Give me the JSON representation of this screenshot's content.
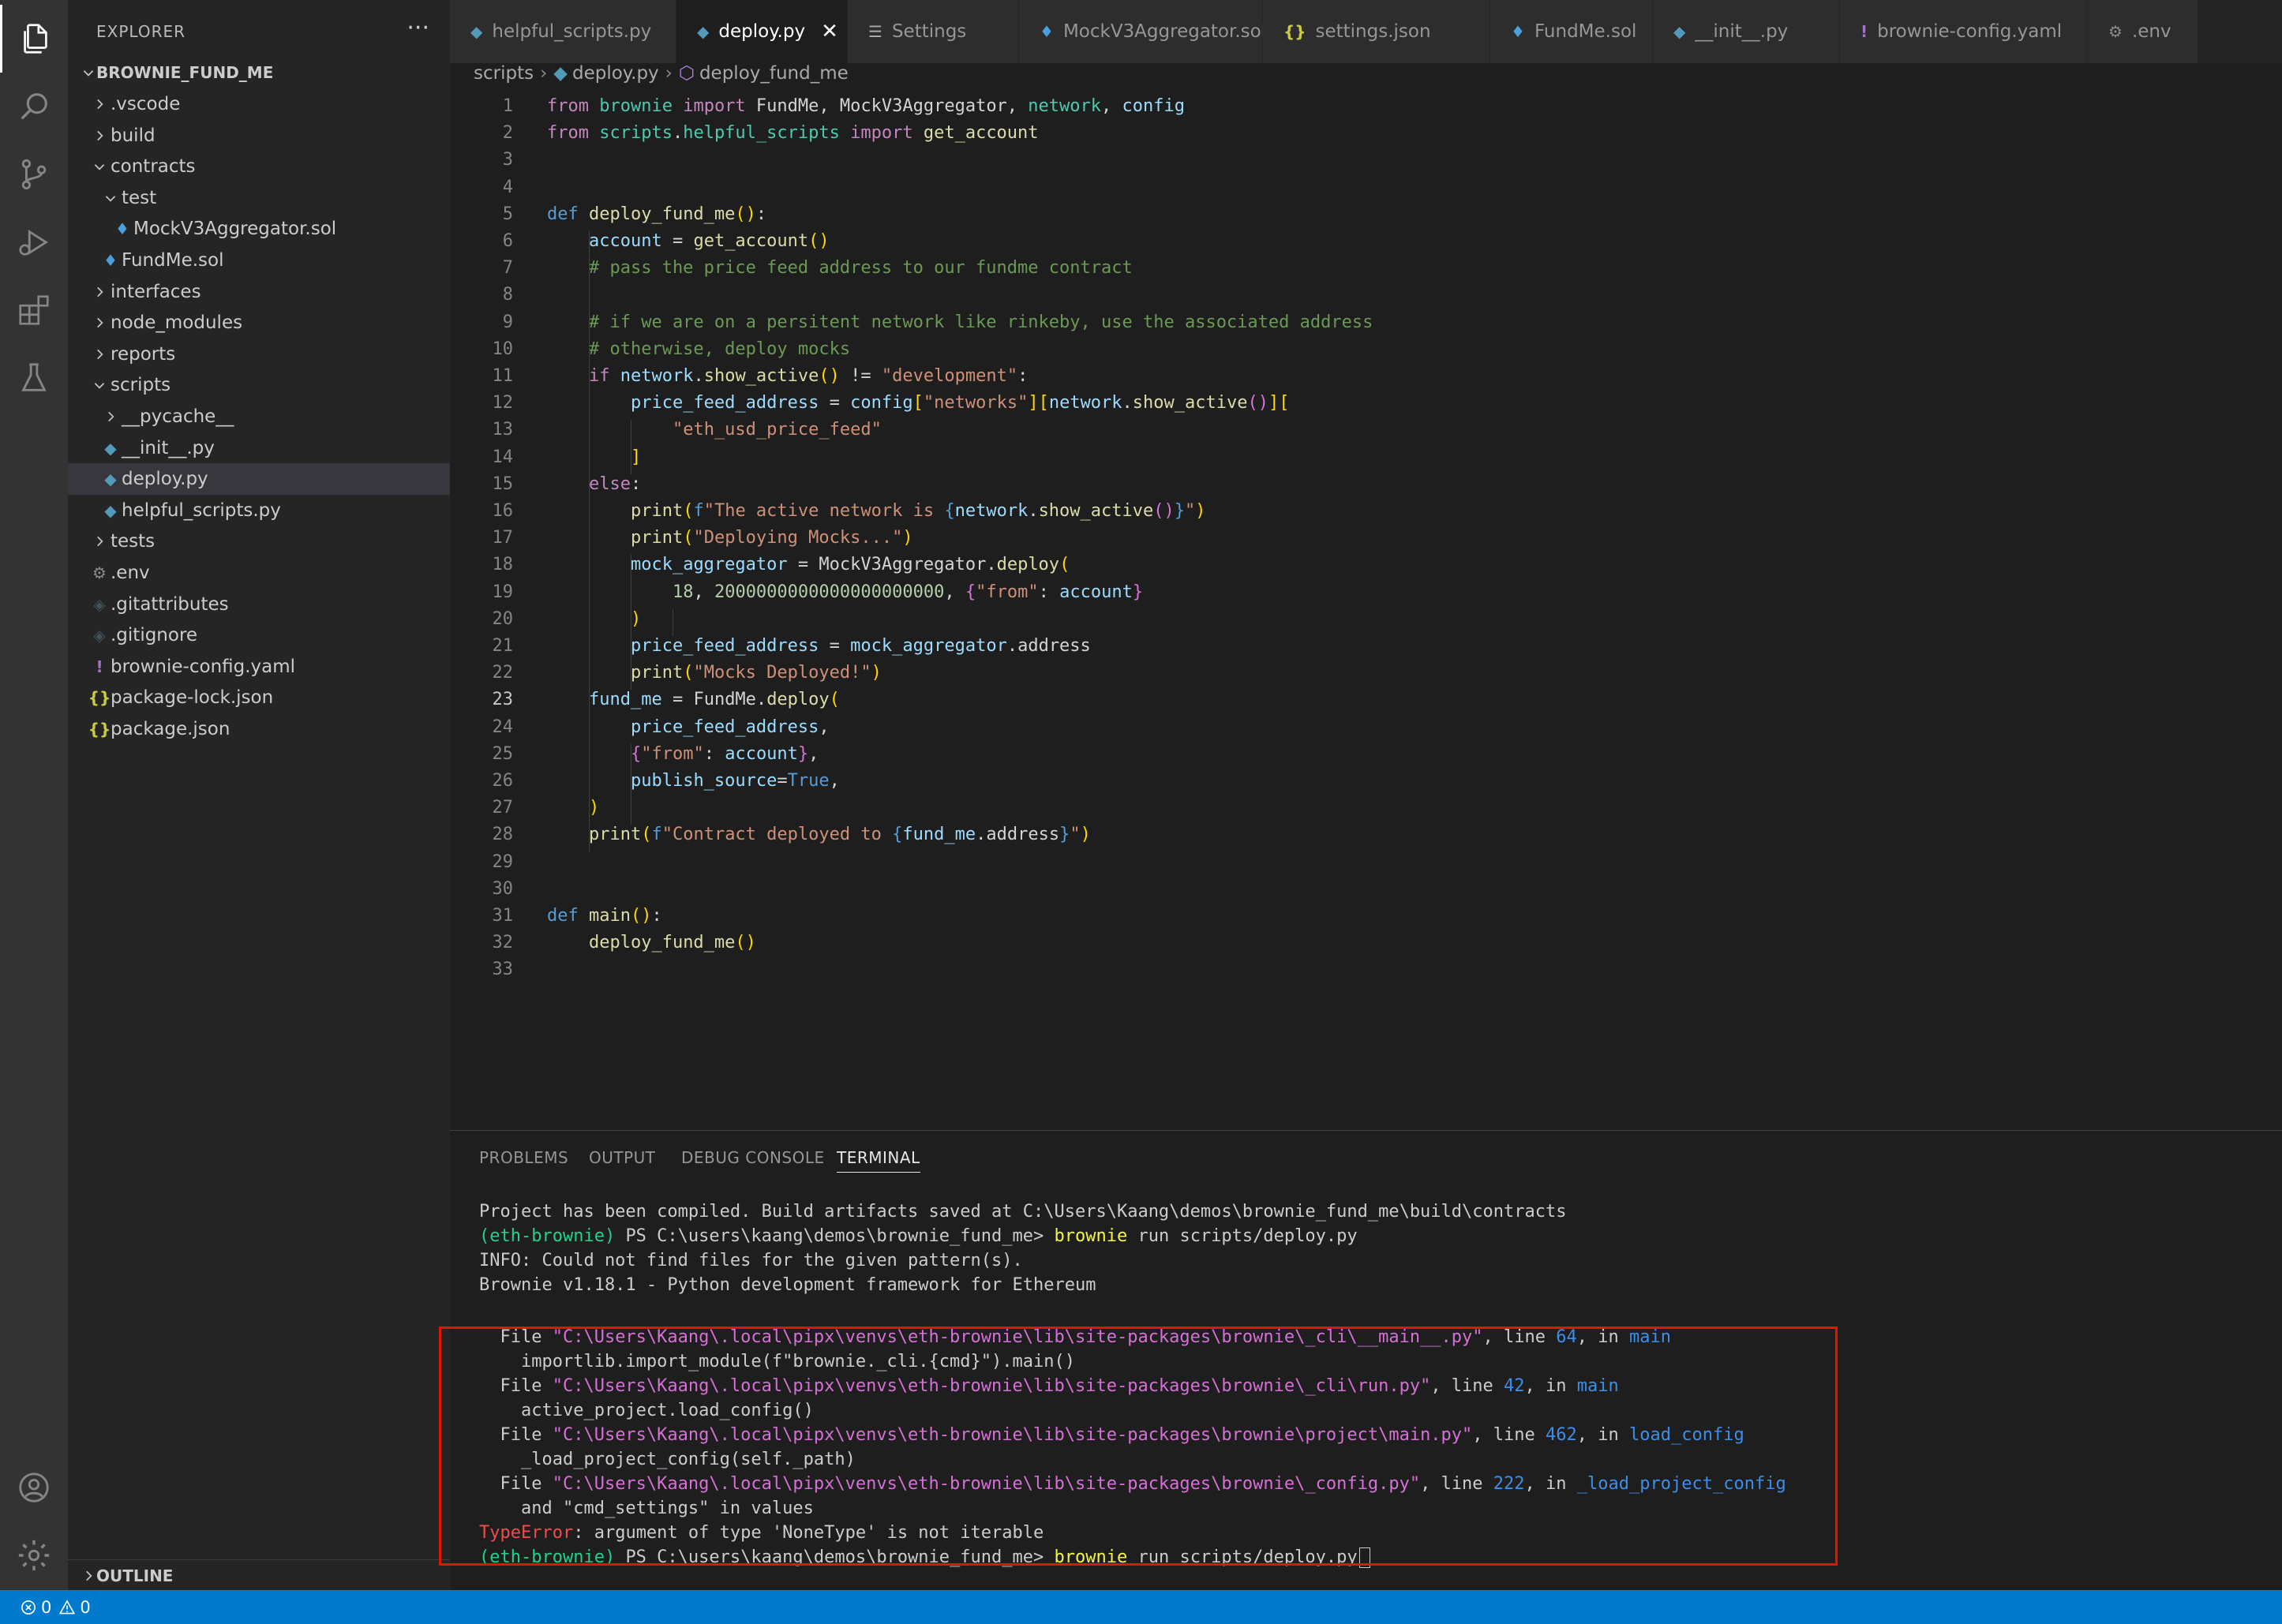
{
  "activity_bar": {
    "items": [
      "files-icon",
      "search-icon",
      "source-control-icon",
      "run-debug-icon",
      "extensions-icon",
      "testing-icon"
    ],
    "bottom": [
      "account-icon",
      "settings-gear-icon"
    ]
  },
  "sidebar": {
    "title": "EXPLORER",
    "more": "···",
    "root": "BROWNIE_FUND_ME",
    "items": [
      {
        "label": ".vscode",
        "kind": "folder",
        "open": false
      },
      {
        "label": "build",
        "kind": "folder",
        "open": false
      },
      {
        "label": "contracts",
        "kind": "folder",
        "open": true
      },
      {
        "label": "test",
        "kind": "folder",
        "open": true
      },
      {
        "label": "MockV3Aggregator.sol",
        "kind": "sol"
      },
      {
        "label": "FundMe.sol",
        "kind": "sol"
      },
      {
        "label": "interfaces",
        "kind": "folder",
        "open": false
      },
      {
        "label": "node_modules",
        "kind": "folder",
        "open": false
      },
      {
        "label": "reports",
        "kind": "folder",
        "open": false
      },
      {
        "label": "scripts",
        "kind": "folder",
        "open": true
      },
      {
        "label": "__pycache__",
        "kind": "folder",
        "open": false
      },
      {
        "label": "__init__.py",
        "kind": "py"
      },
      {
        "label": "deploy.py",
        "kind": "py",
        "selected": true
      },
      {
        "label": "helpful_scripts.py",
        "kind": "py"
      },
      {
        "label": "tests",
        "kind": "folder",
        "open": false
      },
      {
        "label": ".env",
        "kind": "gear"
      },
      {
        "label": ".gitattributes",
        "kind": "git"
      },
      {
        "label": ".gitignore",
        "kind": "git"
      },
      {
        "label": "brownie-config.yaml",
        "kind": "yaml"
      },
      {
        "label": "package-lock.json",
        "kind": "json"
      },
      {
        "label": "package.json",
        "kind": "json"
      }
    ],
    "outline": "OUTLINE"
  },
  "tabs": [
    {
      "label": "helpful_scripts.py",
      "icon": "python-file-icon"
    },
    {
      "label": "deploy.py",
      "icon": "python-file-icon",
      "active": true,
      "close": "✕"
    },
    {
      "label": "Settings",
      "icon": "settings-list-icon"
    },
    {
      "label": "MockV3Aggregator.sol",
      "icon": "solidity-file-icon"
    },
    {
      "label": "settings.json",
      "icon": "json-file-icon"
    },
    {
      "label": "FundMe.sol",
      "icon": "solidity-file-icon"
    },
    {
      "label": "__init__.py",
      "icon": "python-file-icon"
    },
    {
      "label": "brownie-config.yaml",
      "icon": "yaml-file-icon"
    },
    {
      "label": ".env",
      "icon": "env-gear-icon"
    }
  ],
  "breadcrumb": {
    "parts": [
      "scripts",
      "deploy.py",
      "deploy_fund_me"
    ]
  },
  "editor": {
    "current_line": 23,
    "lines": [
      [
        [
          "from ",
          "kw"
        ],
        [
          "brownie ",
          "cls"
        ],
        [
          "import ",
          "kw"
        ],
        [
          "FundMe, MockV3Aggregator, ",
          ""
        ],
        [
          "network",
          "cls"
        ],
        [
          ", ",
          ""
        ],
        [
          "config",
          "var"
        ]
      ],
      [
        [
          "from ",
          "kw"
        ],
        [
          "scripts",
          "cls"
        ],
        [
          ".",
          ""
        ],
        [
          "helpful_scripts ",
          "cls"
        ],
        [
          "import ",
          "kw"
        ],
        [
          "get_account",
          "fn"
        ]
      ],
      [],
      [],
      [
        [
          "def ",
          "kw2"
        ],
        [
          "deploy_fund_me",
          "fn"
        ],
        [
          "()",
          "p1"
        ],
        [
          ":",
          ""
        ]
      ],
      [
        [
          "    ",
          ""
        ],
        [
          "account",
          "var"
        ],
        [
          " = ",
          ""
        ],
        [
          "get_account",
          "fn"
        ],
        [
          "()",
          "p1"
        ]
      ],
      [
        [
          "    # pass the price feed address to our fundme contract",
          "cm"
        ]
      ],
      [],
      [
        [
          "    # if we are on a persitent network like rinkeby, use the associated address",
          "cm"
        ]
      ],
      [
        [
          "    # otherwise, deploy mocks",
          "cm"
        ]
      ],
      [
        [
          "    ",
          ""
        ],
        [
          "if ",
          "kw"
        ],
        [
          "network",
          "var"
        ],
        [
          ".",
          ""
        ],
        [
          "show_active",
          "fn"
        ],
        [
          "()",
          "p1"
        ],
        [
          " != ",
          ""
        ],
        [
          "\"development\"",
          "str"
        ],
        [
          ":",
          ""
        ]
      ],
      [
        [
          "        ",
          ""
        ],
        [
          "price_feed_address",
          "var"
        ],
        [
          " = ",
          ""
        ],
        [
          "config",
          "var"
        ],
        [
          "[",
          "p1"
        ],
        [
          "\"networks\"",
          "str"
        ],
        [
          "]",
          "p1"
        ],
        [
          "[",
          "p1"
        ],
        [
          "network",
          "var"
        ],
        [
          ".",
          ""
        ],
        [
          "show_active",
          "fn"
        ],
        [
          "()",
          "p2"
        ],
        [
          "]",
          "p1"
        ],
        [
          "[",
          "p1"
        ]
      ],
      [
        [
          "            ",
          ""
        ],
        [
          "\"eth_usd_price_feed\"",
          "str"
        ]
      ],
      [
        [
          "        ",
          ""
        ],
        [
          "]",
          "p1"
        ]
      ],
      [
        [
          "    ",
          ""
        ],
        [
          "else",
          "kw"
        ],
        [
          ":",
          ""
        ]
      ],
      [
        [
          "        ",
          ""
        ],
        [
          "print",
          "fn"
        ],
        [
          "(",
          "p1"
        ],
        [
          "f",
          "kw2"
        ],
        [
          "\"The active network is ",
          "str"
        ],
        [
          "{",
          "kw2"
        ],
        [
          "network",
          "var"
        ],
        [
          ".",
          ""
        ],
        [
          "show_active",
          "fn"
        ],
        [
          "()",
          "p2"
        ],
        [
          "}",
          "kw2"
        ],
        [
          "\"",
          "str"
        ],
        [
          ")",
          "p1"
        ]
      ],
      [
        [
          "        ",
          ""
        ],
        [
          "print",
          "fn"
        ],
        [
          "(",
          "p1"
        ],
        [
          "\"Deploying Mocks...\"",
          "str"
        ],
        [
          ")",
          "p1"
        ]
      ],
      [
        [
          "        ",
          ""
        ],
        [
          "mock_aggregator",
          "var"
        ],
        [
          " = ",
          ""
        ],
        [
          "MockV3Aggregator",
          ""
        ],
        [
          ".",
          ""
        ],
        [
          "deploy",
          "fn"
        ],
        [
          "(",
          "p1"
        ]
      ],
      [
        [
          "            ",
          ""
        ],
        [
          "18",
          "num"
        ],
        [
          ", ",
          ""
        ],
        [
          "2000000000000000000000",
          "num"
        ],
        [
          ", ",
          ""
        ],
        [
          "{",
          "p2"
        ],
        [
          "\"from\"",
          "str"
        ],
        [
          ": ",
          ""
        ],
        [
          "account",
          "var"
        ],
        [
          "}",
          "p2"
        ]
      ],
      [
        [
          "        ",
          ""
        ],
        [
          ")",
          "p1"
        ]
      ],
      [
        [
          "        ",
          ""
        ],
        [
          "price_feed_address",
          "var"
        ],
        [
          " = ",
          ""
        ],
        [
          "mock_aggregator",
          "var"
        ],
        [
          ".",
          ""
        ],
        [
          "address",
          ""
        ]
      ],
      [
        [
          "        ",
          ""
        ],
        [
          "print",
          "fn"
        ],
        [
          "(",
          "p1"
        ],
        [
          "\"Mocks Deployed!\"",
          "str"
        ],
        [
          ")",
          "p1"
        ]
      ],
      [
        [
          "    ",
          ""
        ],
        [
          "fund_me",
          "var"
        ],
        [
          " = ",
          ""
        ],
        [
          "FundMe",
          ""
        ],
        [
          ".",
          ""
        ],
        [
          "deploy",
          "fn"
        ],
        [
          "(",
          "p1"
        ]
      ],
      [
        [
          "        ",
          ""
        ],
        [
          "price_feed_address",
          "var"
        ],
        [
          ",",
          ""
        ]
      ],
      [
        [
          "        ",
          ""
        ],
        [
          "{",
          "p2"
        ],
        [
          "\"from\"",
          "str"
        ],
        [
          ": ",
          ""
        ],
        [
          "account",
          "var"
        ],
        [
          "}",
          "p2"
        ],
        [
          ",",
          ""
        ]
      ],
      [
        [
          "        ",
          ""
        ],
        [
          "publish_source",
          "var"
        ],
        [
          "=",
          ""
        ],
        [
          "True",
          "kw2"
        ],
        [
          ",",
          ""
        ]
      ],
      [
        [
          "    ",
          ""
        ],
        [
          ")",
          "p1"
        ]
      ],
      [
        [
          "    ",
          ""
        ],
        [
          "print",
          "fn"
        ],
        [
          "(",
          "p1"
        ],
        [
          "f",
          "kw2"
        ],
        [
          "\"Contract deployed to ",
          "str"
        ],
        [
          "{",
          "kw2"
        ],
        [
          "fund_me",
          "var"
        ],
        [
          ".",
          ""
        ],
        [
          "address",
          ""
        ],
        [
          "}",
          "kw2"
        ],
        [
          "\"",
          "str"
        ],
        [
          ")",
          "p1"
        ]
      ],
      [],
      [],
      [
        [
          "def ",
          "kw2"
        ],
        [
          "main",
          "fn"
        ],
        [
          "()",
          "p1"
        ],
        [
          ":",
          ""
        ]
      ],
      [
        [
          "    ",
          ""
        ],
        [
          "deploy_fund_me",
          "fn"
        ],
        [
          "()",
          "p1"
        ]
      ],
      []
    ]
  },
  "panel": {
    "tabs": [
      "PROBLEMS",
      "OUTPUT",
      "DEBUG CONSOLE",
      "TERMINAL"
    ],
    "active_tab": "TERMINAL",
    "terminal": [
      [
        [
          "Project has been compiled. Build artifacts saved at C:\\Users\\Kaang\\demos\\brownie_fund_me\\build\\contracts",
          ""
        ]
      ],
      [
        [
          "(eth-brownie) ",
          "tg"
        ],
        [
          "PS C:\\users\\kaang\\demos\\brownie_fund_me> ",
          ""
        ],
        [
          "brownie",
          "ty"
        ],
        [
          " run scripts/deploy.py",
          ""
        ]
      ],
      [
        [
          "INFO: Could not find files for the given pattern(s).",
          ""
        ]
      ],
      [
        [
          "Brownie v1.18.1 - Python development framework for Ethereum",
          ""
        ]
      ],
      [],
      [
        [
          "  File ",
          ""
        ],
        [
          "\"C:\\Users\\Kaang\\.local\\pipx\\venvs\\eth-brownie\\lib\\site-packages\\brownie\\_cli\\__main__.py\"",
          "tm"
        ],
        [
          ", line ",
          ""
        ],
        [
          "64",
          "tb"
        ],
        [
          ", in ",
          ""
        ],
        [
          "main",
          "tb"
        ]
      ],
      [
        [
          "    importlib.import_module(f\"brownie._cli.{cmd}\").main()",
          ""
        ]
      ],
      [
        [
          "  File ",
          ""
        ],
        [
          "\"C:\\Users\\Kaang\\.local\\pipx\\venvs\\eth-brownie\\lib\\site-packages\\brownie\\_cli\\run.py\"",
          "tm"
        ],
        [
          ", line ",
          ""
        ],
        [
          "42",
          "tb"
        ],
        [
          ", in ",
          ""
        ],
        [
          "main",
          "tb"
        ]
      ],
      [
        [
          "    active_project.load_config()",
          ""
        ]
      ],
      [
        [
          "  File ",
          ""
        ],
        [
          "\"C:\\Users\\Kaang\\.local\\pipx\\venvs\\eth-brownie\\lib\\site-packages\\brownie\\project\\main.py\"",
          "tm"
        ],
        [
          ", line ",
          ""
        ],
        [
          "462",
          "tb"
        ],
        [
          ", in ",
          ""
        ],
        [
          "load_config",
          "tb"
        ]
      ],
      [
        [
          "    _load_project_config(self._path)",
          ""
        ]
      ],
      [
        [
          "  File ",
          ""
        ],
        [
          "\"C:\\Users\\Kaang\\.local\\pipx\\venvs\\eth-brownie\\lib\\site-packages\\brownie\\_config.py\"",
          "tm"
        ],
        [
          ", line ",
          ""
        ],
        [
          "222",
          "tb"
        ],
        [
          ", in ",
          ""
        ],
        [
          "_load_project_config",
          "tb"
        ]
      ],
      [
        [
          "    and \"cmd_settings\" in values",
          ""
        ]
      ],
      [
        [
          "TypeError",
          "tr"
        ],
        [
          ": argument of type 'NoneType' is not iterable",
          ""
        ]
      ],
      [
        [
          "(eth-brownie) ",
          "tg"
        ],
        [
          "PS C:\\users\\kaang\\demos\\brownie_fund_me> ",
          ""
        ],
        [
          "brownie",
          "ty"
        ],
        [
          " run scripts/deploy.py",
          ""
        ]
      ]
    ]
  },
  "statusbar": {
    "errors": "0",
    "warnings": "0"
  },
  "colors": {
    "accent": "#007acc",
    "error_box": "#e51400",
    "selected_row": "#37373d"
  }
}
